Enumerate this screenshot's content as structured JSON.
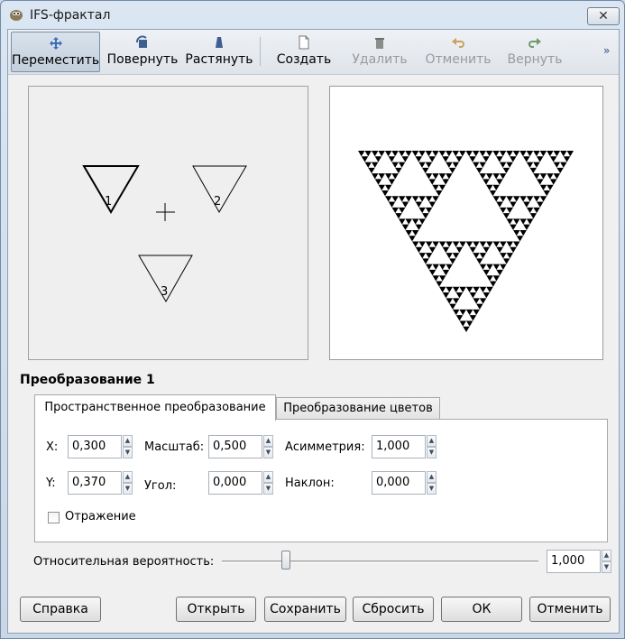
{
  "window": {
    "title": "IFS-фрактал",
    "close_glyph": "✕"
  },
  "toolbar": {
    "move": "Переместить",
    "rotate": "Повернуть",
    "stretch": "Растянуть",
    "create": "Создать",
    "delete": "Удалить",
    "undo": "Отменить",
    "redo": "Вернуть",
    "more": "»"
  },
  "design": {
    "triangles": [
      "1",
      "2",
      "3"
    ]
  },
  "transform": {
    "title": "Преобразование 1",
    "tabs": {
      "spatial": "Пространственное преобразование",
      "color": "Преобразование цветов"
    },
    "fields": {
      "x_label": "X:",
      "x_value": "0,300",
      "y_label": "Y:",
      "y_value": "0,370",
      "scale_label": "Масштаб:",
      "scale_value": "0,500",
      "angle_label": "Угол:",
      "angle_value": "0,000",
      "asym_label": "Асимметрия:",
      "asym_value": "1,000",
      "shear_label": "Наклон:",
      "shear_value": "0,000"
    },
    "flip_label": "Отражение",
    "flip_checked": false
  },
  "probability": {
    "label": "Относительная вероятность:",
    "value": "1,000"
  },
  "buttons": {
    "help": "Справка",
    "open": "Открыть",
    "save": "Сохранить",
    "reset": "Сбросить",
    "ok": "ОК",
    "cancel": "Отменить"
  },
  "icons": {
    "move": "move-arrows-icon",
    "rotate": "rotate-icon",
    "stretch": "stretch-icon",
    "create": "new-document-icon",
    "delete": "trash-icon",
    "undo": "undo-icon",
    "redo": "redo-icon"
  }
}
